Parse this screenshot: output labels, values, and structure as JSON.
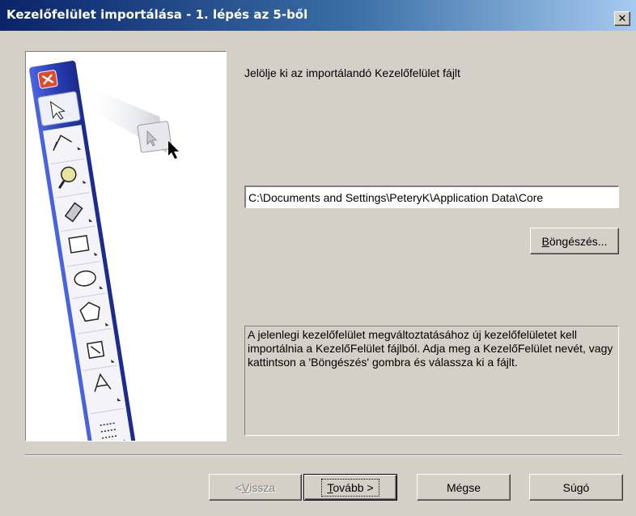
{
  "window": {
    "title": "Kezelőfelület importálása - 1. lépés az 5-ből",
    "close_glyph": "✕"
  },
  "illustration": {
    "icon": "corel-toolbox-toolbar-illustration",
    "toolbar_color": "#2a3fb8"
  },
  "main": {
    "instruction": "Jelölje ki az importálandó Kezelőfelület fájlt",
    "path_value": "C:\\Documents and Settings\\PeteryK\\Application Data\\Core",
    "browse_label_mn": "B",
    "browse_label_rest": "öngészés...",
    "description": "A jelenlegi kezelőfelület megváltoztatásához új kezelőfelületet kell importálnia a KezelőFelület fájlból. Adja meg a KezelőFelület nevét, vagy kattintson a 'Böngészés' gombra és válassza ki a fájlt."
  },
  "footer": {
    "back_prefix": "< ",
    "back_mn": "V",
    "back_rest": "issza",
    "next_mn": "T",
    "next_rest": "ovább >",
    "cancel_label": "Mégse",
    "help_label": "Súgó"
  }
}
